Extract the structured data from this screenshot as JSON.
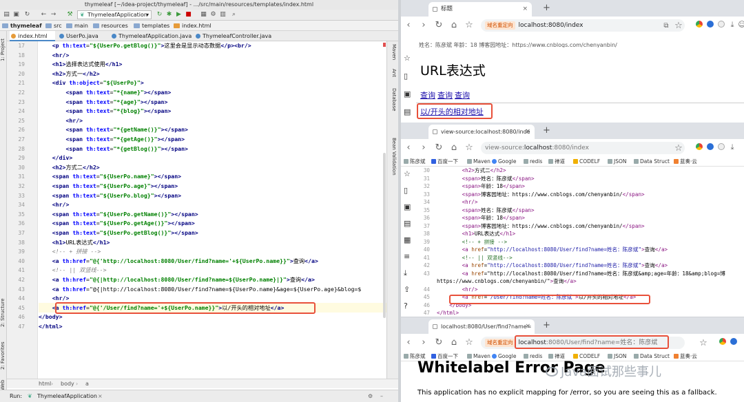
{
  "ide": {
    "window_title": "thymeleaf [~/idea-project/thymeleaf] - .../src/main/resources/templates/index.html",
    "run_config": "ThymeleafApplication",
    "breadcrumb": [
      "thymeleaf",
      "src",
      "main",
      "resources",
      "templates",
      "index.html"
    ],
    "tabs": [
      "index.html",
      "UserPo.java",
      "ThymeleafApplication.java",
      "ThymeleafController.java"
    ],
    "left_tools": [
      "1: Project",
      "2: Structure",
      "2: Favorites",
      "Web"
    ],
    "right_tools": [
      "Maven",
      "Ant",
      "Database",
      "Bean Validation"
    ],
    "line_numbers": [
      "17",
      "18",
      "19",
      "20",
      "21",
      "22",
      "23",
      "24",
      "25",
      "26",
      "27",
      "28",
      "29",
      "30",
      "31",
      "32",
      "33",
      "34",
      "35",
      "36",
      "37",
      "38",
      "39",
      "40",
      "41",
      "42",
      "43",
      "44",
      "45",
      "46",
      "47"
    ],
    "code_lines": [
      "    <p th:text=\"${UserPo.getBlog()}\">这里会是显示动态数据</p><br/>",
      "    <hr/>",
      "    <h1>选择表达式使用</h1>",
      "    <h2>方式一</h2>",
      "    <div th:object=\"${UserPo}\">",
      "        <span th:text=\"*{name}\"></span>",
      "        <span th:text=\"*{age}\"></span>",
      "        <span th:text=\"*{blog}\"></span>",
      "        <hr/>",
      "        <span th:text=\"*{getName()}\"></span>",
      "        <span th:text=\"*{getAge()}\"></span>",
      "        <span th:text=\"*{getBlog()}\"></span>",
      "    </div>",
      "    <h2>方式二</h2>",
      "    <span th:text=\"${UserPo.name}\"></span>",
      "    <span th:text=\"${UserPo.age}\"></span>",
      "    <span th:text=\"${UserPo.blog}\"></span>",
      "    <hr/>",
      "    <span th:text=\"${UserPo.getName()}\"></span>",
      "    <span th:text=\"${UserPo.getAge()}\"></span>",
      "    <span th:text=\"${UserPo.getBlog()}\"></span>",
      "    <h1>URL表达式</h1>",
      "    <!-- + 拼接 -->",
      "    <a th:href=\"@{'http://localhost:8080/User/find?name='+${UserPo.name}}\">查询</a>",
      "    <!-- || 双竖线-->",
      "    <a th:href=\"@{|http://localhost:8080/User/find?name=${UserPo.name}|}\">查询</a>",
      "    <a th:href=\"@{|http://localhost:8080/User/find?name=${UserPo.name}&age=${UserPo.age}&blog=$",
      "    <hr/>",
      "    <a th:href=\"@{'/User/find?name='+${UserPo.name}}\">以/开头的相对地址</a>",
      "</body>",
      "</html>"
    ],
    "status_path": [
      "html",
      "body",
      "a"
    ],
    "run_label": "Run:",
    "run_app": "ThymeleafApplication"
  },
  "browser1": {
    "tab_title": "标题",
    "url": "localhost:8080/index",
    "redirect_label": "域名重定向",
    "top_text": "姓名：陈彦斌 年龄：18 博客园地址：https://www.cnblogs.com/chenyanbin/",
    "heading": "URL表达式",
    "links": [
      "查询",
      "查询",
      "查询"
    ],
    "relative_link": "以/开头的相对地址"
  },
  "bookmarks": [
    "陈彦斌",
    "百度一下",
    "Maven",
    "Google",
    "redis",
    "禅道",
    "CODELF",
    "JSON",
    "Data Struct",
    "蓝奏·云"
  ],
  "browser2": {
    "tab_title": "view-source:localhost:8080/inde",
    "url_prefix": "view-source:",
    "url_host": "localhost",
    "url_rest": ":8080/index",
    "line_numbers": [
      "30",
      "31",
      "32",
      "33",
      "34",
      "35",
      "36",
      "37",
      "38",
      "39",
      "40",
      "41",
      "42",
      "43",
      "",
      "44",
      "45",
      "46",
      "47"
    ],
    "source_lines": [
      "        <h2>方式二</h2>",
      "        <span>姓名：陈彦斌</span>",
      "        <span>年龄：18</span>",
      "        <span>博客园地址：https://www.cnblogs.com/chenyanbin/</span>",
      "        <hr/>",
      "        <span>姓名：陈彦斌</span>",
      "        <span>年龄：18</span>",
      "        <span>博客园地址：https://www.cnblogs.com/chenyanbin/</span>",
      "        <h1>URL表达式</h1>",
      "        <!-- + 拼接 -->",
      "        <a href=\"http://localhost:8080/User/find?name=姓名：陈彦斌\">查询</a>",
      "        <!-- || 双竖线-->",
      "        <a href=\"http://localhost:8080/User/find?name=姓名：陈彦斌\">查询</a>",
      "        <a href=\"http://localhost:8080/User/find?name=姓名：陈彦斌&amp;age=年龄：18&amp;blog=博",
      "https://www.cnblogs.com/chenyanbin/\">查询</a>",
      "        <hr/>",
      "        <a href=\"/User/find?name=姓名：陈彦斌\">以/开头的相对地址</a>",
      "    </body>",
      "</html>"
    ]
  },
  "browser3": {
    "tab_title": "localhost:8080/User/find?name=",
    "redirect_label": "域名重定向",
    "url_host": "localhost",
    "url_rest": ":8080/User/find?name=姓名：陈彦斌",
    "heading": "Whitelabel Error Page",
    "message": "This application has no explicit mapping for /error, so you are seeing this as a fallback."
  },
  "watermark": "Java面试那些事儿"
}
